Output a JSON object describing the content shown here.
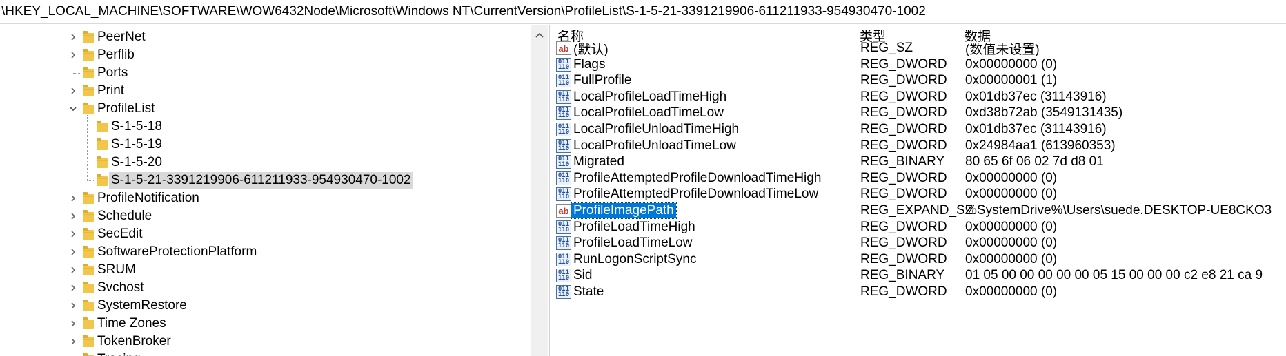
{
  "address_bar": {
    "path": "\\HKEY_LOCAL_MACHINE\\SOFTWARE\\WOW6432Node\\Microsoft\\Windows NT\\CurrentVersion\\ProfileList\\S-1-5-21-3391219906-611211933-954930470-1002"
  },
  "tree": {
    "items": [
      {
        "label": "PeerNet",
        "level": 0,
        "expander": "collapsed"
      },
      {
        "label": "Perflib",
        "level": 0,
        "expander": "collapsed"
      },
      {
        "label": "Ports",
        "level": 0,
        "expander": "none"
      },
      {
        "label": "Print",
        "level": 0,
        "expander": "collapsed"
      },
      {
        "label": "ProfileList",
        "level": 0,
        "expander": "expanded"
      },
      {
        "label": "S-1-5-18",
        "level": 1,
        "expander": "none"
      },
      {
        "label": "S-1-5-19",
        "level": 1,
        "expander": "none"
      },
      {
        "label": "S-1-5-20",
        "level": 1,
        "expander": "none"
      },
      {
        "label": "S-1-5-21-3391219906-611211933-954930470-1002",
        "level": 1,
        "expander": "none",
        "selected": true
      },
      {
        "label": "ProfileNotification",
        "level": 0,
        "expander": "collapsed"
      },
      {
        "label": "Schedule",
        "level": 0,
        "expander": "collapsed"
      },
      {
        "label": "SecEdit",
        "level": 0,
        "expander": "collapsed"
      },
      {
        "label": "SoftwareProtectionPlatform",
        "level": 0,
        "expander": "collapsed"
      },
      {
        "label": "SRUM",
        "level": 0,
        "expander": "collapsed"
      },
      {
        "label": "Svchost",
        "level": 0,
        "expander": "collapsed"
      },
      {
        "label": "SystemRestore",
        "level": 0,
        "expander": "collapsed"
      },
      {
        "label": "Time Zones",
        "level": 0,
        "expander": "collapsed"
      },
      {
        "label": "TokenBroker",
        "level": 0,
        "expander": "collapsed"
      },
      {
        "label": "Tracing",
        "level": 0,
        "expander": "collapsed"
      }
    ]
  },
  "list": {
    "columns": {
      "name": "名称",
      "type": "类型",
      "data": "数据"
    },
    "rows": [
      {
        "icon": "string-value-icon",
        "name": "(默认)",
        "type": "REG_SZ",
        "data": "(数值未设置)"
      },
      {
        "icon": "binary-value-icon",
        "name": "Flags",
        "type": "REG_DWORD",
        "data": "0x00000000 (0)"
      },
      {
        "icon": "binary-value-icon",
        "name": "FullProfile",
        "type": "REG_DWORD",
        "data": "0x00000001 (1)"
      },
      {
        "icon": "binary-value-icon",
        "name": "LocalProfileLoadTimeHigh",
        "type": "REG_DWORD",
        "data": "0x01db37ec (31143916)"
      },
      {
        "icon": "binary-value-icon",
        "name": "LocalProfileLoadTimeLow",
        "type": "REG_DWORD",
        "data": "0xd38b72ab (3549131435)"
      },
      {
        "icon": "binary-value-icon",
        "name": "LocalProfileUnloadTimeHigh",
        "type": "REG_DWORD",
        "data": "0x01db37ec (31143916)"
      },
      {
        "icon": "binary-value-icon",
        "name": "LocalProfileUnloadTimeLow",
        "type": "REG_DWORD",
        "data": "0x24984aa1 (613960353)"
      },
      {
        "icon": "binary-value-icon",
        "name": "Migrated",
        "type": "REG_BINARY",
        "data": "80 65 6f 06 02 7d d8 01"
      },
      {
        "icon": "binary-value-icon",
        "name": "ProfileAttemptedProfileDownloadTimeHigh",
        "type": "REG_DWORD",
        "data": "0x00000000 (0)"
      },
      {
        "icon": "binary-value-icon",
        "name": "ProfileAttemptedProfileDownloadTimeLow",
        "type": "REG_DWORD",
        "data": "0x00000000 (0)"
      },
      {
        "icon": "string-value-icon",
        "name": "ProfileImagePath",
        "type": "REG_EXPAND_SZ",
        "data": "%SystemDrive%\\Users\\suede.DESKTOP-UE8CKO3",
        "selected": true
      },
      {
        "icon": "binary-value-icon",
        "name": "ProfileLoadTimeHigh",
        "type": "REG_DWORD",
        "data": "0x00000000 (0)"
      },
      {
        "icon": "binary-value-icon",
        "name": "ProfileLoadTimeLow",
        "type": "REG_DWORD",
        "data": "0x00000000 (0)"
      },
      {
        "icon": "binary-value-icon",
        "name": "RunLogonScriptSync",
        "type": "REG_DWORD",
        "data": "0x00000000 (0)"
      },
      {
        "icon": "binary-value-icon",
        "name": "Sid",
        "type": "REG_BINARY",
        "data": "01 05 00 00 00 00 00 05 15 00 00 00 c2 e8 21 ca 9"
      },
      {
        "icon": "binary-value-icon",
        "name": "State",
        "type": "REG_DWORD",
        "data": "0x00000000 (0)"
      }
    ]
  },
  "icons": {
    "string_glyph": "ab",
    "binary_glyph_top": "011",
    "binary_glyph_bottom": "110"
  },
  "colors": {
    "selection": "#0078d7",
    "tree_selection": "#d9d9d9",
    "folder": "#f2c64b"
  }
}
